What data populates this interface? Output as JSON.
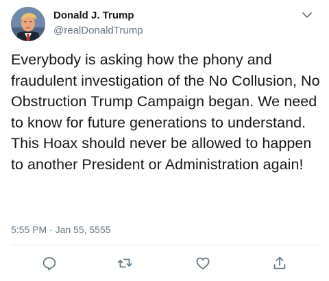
{
  "tweet": {
    "author": {
      "display_name": "Donald J. Trump",
      "handle": "@realDonaldTrump",
      "avatar_icon": "profile-photo"
    },
    "text": "Everybody is asking how the phony and fraudulent investigation of the No Collusion, No Obstruction Trump Campaign began. We need to know for future generations to understand. This Hoax should never be allowed to happen to another President or Administration again!",
    "timestamp": "5:55 PM · Jan 55, 5555",
    "menu_icon": "chevron-down-icon"
  },
  "actions": [
    {
      "name": "reply",
      "icon": "reply-icon"
    },
    {
      "name": "retweet",
      "icon": "retweet-icon"
    },
    {
      "name": "like",
      "icon": "heart-icon"
    },
    {
      "name": "share",
      "icon": "share-icon"
    }
  ],
  "colors": {
    "text": "#14171a",
    "secondary_text": "#657786",
    "icon": "#657786",
    "divider": "#e1e8ed",
    "background": "#ffffff"
  }
}
